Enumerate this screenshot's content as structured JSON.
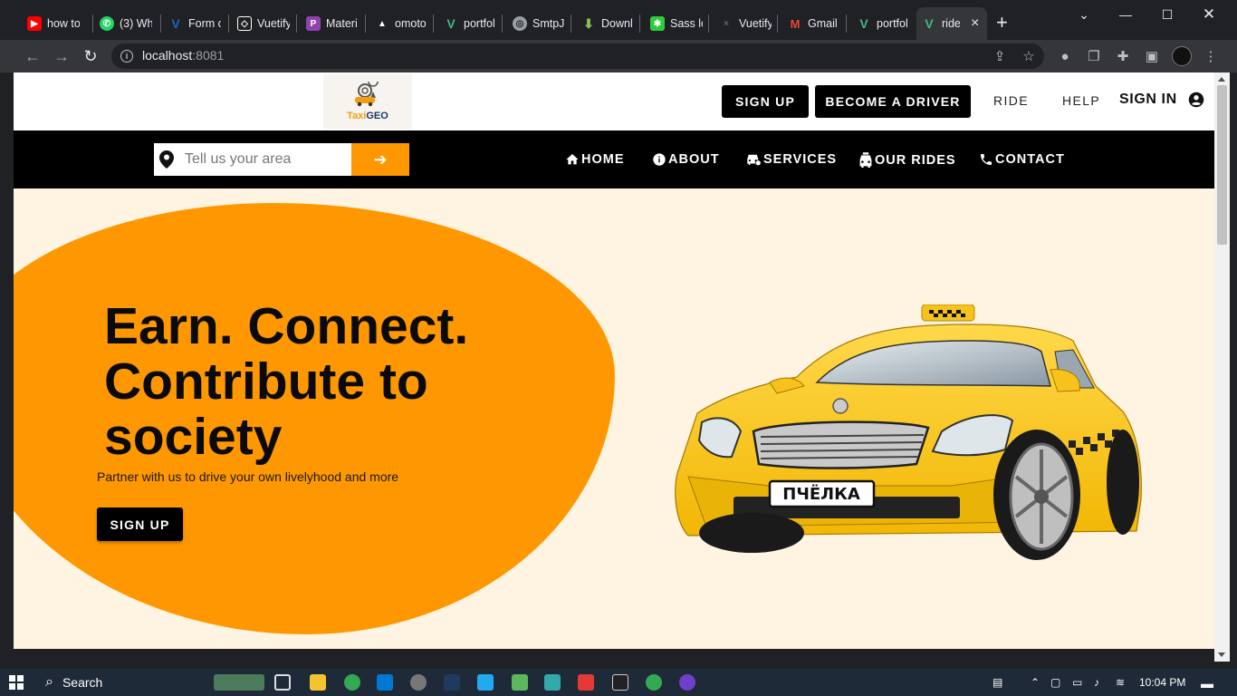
{
  "browser": {
    "tabs": [
      {
        "title": "how to",
        "icon": "youtube-icon",
        "color": "#ff0000"
      },
      {
        "title": "(3) Wh",
        "icon": "whatsapp-icon",
        "color": "#25d366"
      },
      {
        "title": "Form c",
        "icon": "vuetify-icon",
        "color": "#1867c0"
      },
      {
        "title": "Vuetify",
        "icon": "codepen-icon",
        "color": "#ffffff"
      },
      {
        "title": "Materi",
        "icon": "materialize-icon",
        "color": "#8e44ad"
      },
      {
        "title": "omoto",
        "icon": "triangle-icon",
        "color": "#ffffff"
      },
      {
        "title": "portfol",
        "icon": "vue-icon",
        "color": "#41b883"
      },
      {
        "title": "SmtpJS",
        "icon": "globe-icon",
        "color": "#9aa0a6"
      },
      {
        "title": "Downl",
        "icon": "download-icon",
        "color": "#8bc34a"
      },
      {
        "title": "Sass lo",
        "icon": "sass-icon",
        "color": "#2ecc40"
      },
      {
        "title": "Vuetify",
        "icon": "page-icon",
        "color": "#5f6368"
      },
      {
        "title": "Gmail",
        "icon": "gmail-icon",
        "color": "#ea4335"
      },
      {
        "title": "portfol",
        "icon": "vue-icon",
        "color": "#41b883"
      },
      {
        "title": "ride",
        "icon": "vue-icon",
        "color": "#41b883"
      }
    ],
    "url_host": "localhost",
    "url_port": ":8081"
  },
  "header": {
    "logo_text_1": "Taxi",
    "logo_text_2": "GEO",
    "signup_label": "SIGN UP",
    "driver_label": "BECOME A DRIVER",
    "ride_label": "RIDE",
    "help_label": "HELP",
    "signin_label": "SIGN IN"
  },
  "nav": {
    "search_placeholder": "Tell us your area",
    "links": [
      "HOME",
      "ABOUT",
      "SERVICES",
      "OUR RIDES",
      "CONTACT"
    ]
  },
  "hero": {
    "headline_1": "Earn. Connect.",
    "headline_2": "Contribute to",
    "headline_3": "society",
    "subtext": "Partner with us to drive your own livelyhood and more",
    "button_label": "SIGN UP",
    "plate_text": "ПЧЁЛКА"
  },
  "taskbar": {
    "search_label": "Search",
    "time": "10:04 PM"
  },
  "colors": {
    "accent": "#ff9800",
    "page_bg": "#fff3e1",
    "dark": "#000000"
  }
}
